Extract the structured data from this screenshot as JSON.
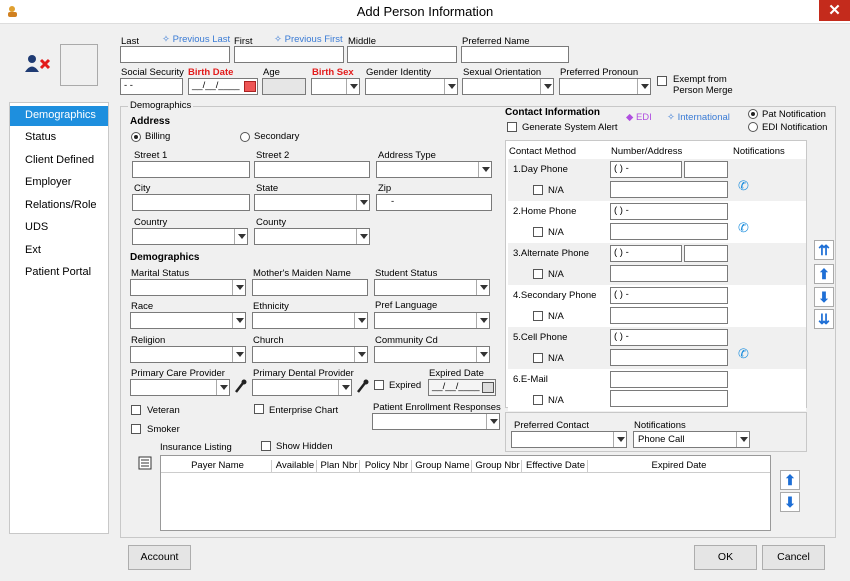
{
  "window": {
    "title": "Add Person Information",
    "close": "✕"
  },
  "name_row": {
    "last": "Last",
    "previous_last": "Previous Last",
    "first": "First",
    "previous_first": "Previous First",
    "middle": "Middle",
    "preferred_name": "Preferred Name"
  },
  "id_row": {
    "ssn": "Social Security",
    "ssn_value": "- -",
    "birth_date": "Birth Date",
    "birth_value": "__/__/____",
    "age": "Age",
    "birth_sex": "Birth Sex",
    "gender_identity": "Gender Identity",
    "sexual_orientation": "Sexual Orientation",
    "preferred_pronoun": "Preferred Pronoun",
    "exempt": "Exempt from",
    "exempt2": "Person Merge"
  },
  "sidebar": {
    "items": [
      "Demographics",
      "Status",
      "Client Defined",
      "Employer",
      "Relations/Role",
      "UDS",
      "Ext",
      "Patient Portal"
    ]
  },
  "demographics": {
    "group": "Demographics",
    "address": "Address",
    "billing": "Billing",
    "secondary": "Secondary",
    "street1": "Street 1",
    "street2": "Street 2",
    "address_type": "Address Type",
    "city": "City",
    "state": "State",
    "zip": "Zip",
    "zip_value": "-",
    "country": "Country",
    "county": "County",
    "demo_head": "Demographics",
    "marital": "Marital Status",
    "maiden": "Mother's Maiden Name",
    "student": "Student Status",
    "race": "Race",
    "ethnicity": "Ethnicity",
    "pref_lang": "Pref Language",
    "religion": "Religion",
    "church": "Church",
    "community": "Community Cd",
    "pcp": "Primary Care Provider",
    "pdp": "Primary Dental Provider",
    "expired": "Expired",
    "expired_date": "Expired Date",
    "expired_value": "__/__/____",
    "veteran": "Veteran",
    "enterprise": "Enterprise Chart",
    "smoker": "Smoker",
    "enrollment": "Patient Enrollment Responses"
  },
  "contact": {
    "title": "Contact Information",
    "edi": "EDI",
    "international": "International",
    "pat_notification": "Pat Notification",
    "edi_notification": "EDI Notification",
    "generate_alert": "Generate System Alert",
    "col_method": "Contact Method",
    "col_number": "Number/Address",
    "col_notifications": "Notifications",
    "rows": [
      {
        "label": "1.Day Phone",
        "value": "(   )   -",
        "na": "N/A"
      },
      {
        "label": "2.Home Phone",
        "value": "(   )   -",
        "na": "N/A"
      },
      {
        "label": "3.Alternate Phone",
        "value": "(   )   -",
        "na": "N/A"
      },
      {
        "label": "4.Secondary Phone",
        "value": "(   )   -",
        "na": "N/A"
      },
      {
        "label": "5.Cell Phone",
        "value": "(   )   -",
        "na": "N/A"
      },
      {
        "label": "6.E-Mail",
        "value": "",
        "na": "N/A"
      }
    ],
    "preferred_contact": "Preferred Contact",
    "notifications": "Notifications",
    "notifications_value": "Phone Call"
  },
  "insurance": {
    "title": "Insurance Listing",
    "show_hidden": "Show Hidden",
    "columns": [
      "Payer Name",
      "Available",
      "Plan Nbr",
      "Policy Nbr",
      "Group Name",
      "Group Nbr",
      "Effective Date",
      "Expired Date"
    ]
  },
  "footer": {
    "account": "Account",
    "ok": "OK",
    "cancel": "Cancel"
  }
}
